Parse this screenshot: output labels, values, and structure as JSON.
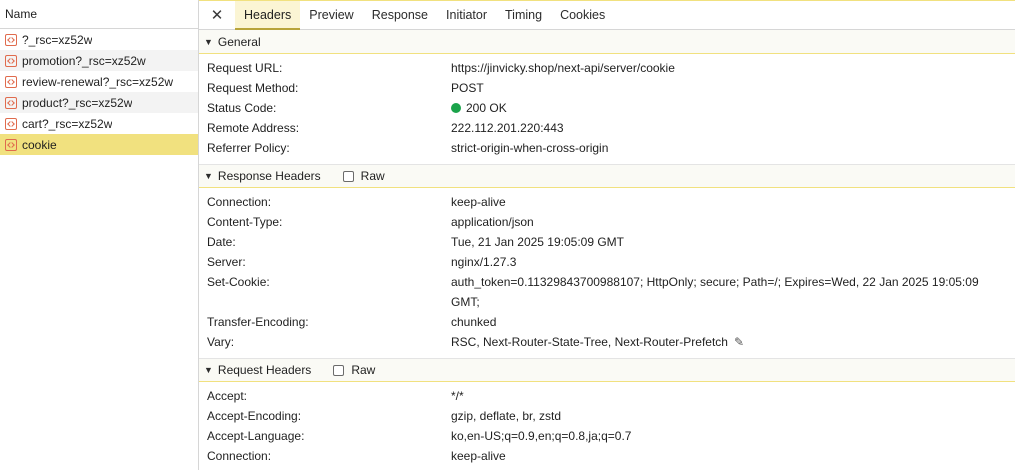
{
  "requests": {
    "header": "Name",
    "items": [
      {
        "label": "?_rsc=xz52w"
      },
      {
        "label": "promotion?_rsc=xz52w"
      },
      {
        "label": "review-renewal?_rsc=xz52w"
      },
      {
        "label": "product?_rsc=xz52w"
      },
      {
        "label": "cart?_rsc=xz52w"
      },
      {
        "label": "cookie"
      }
    ]
  },
  "tabs": {
    "close": "✕",
    "items": [
      {
        "label": "Headers"
      },
      {
        "label": "Preview"
      },
      {
        "label": "Response"
      },
      {
        "label": "Initiator"
      },
      {
        "label": "Timing"
      },
      {
        "label": "Cookies"
      }
    ]
  },
  "general": {
    "title": "General",
    "rows": [
      {
        "key": "Request URL:",
        "value": "https://jinvicky.shop/next-api/server/cookie"
      },
      {
        "key": "Request Method:",
        "value": "POST"
      },
      {
        "key": "Status Code:",
        "value": "200 OK"
      },
      {
        "key": "Remote Address:",
        "value": "222.112.201.220:443"
      },
      {
        "key": "Referrer Policy:",
        "value": "strict-origin-when-cross-origin"
      }
    ]
  },
  "response_headers": {
    "title": "Response Headers",
    "raw": "Raw",
    "rows": [
      {
        "key": "Connection:",
        "value": "keep-alive"
      },
      {
        "key": "Content-Type:",
        "value": "application/json"
      },
      {
        "key": "Date:",
        "value": "Tue, 21 Jan 2025 19:05:09 GMT"
      },
      {
        "key": "Server:",
        "value": "nginx/1.27.3"
      },
      {
        "key": "Set-Cookie:",
        "value": "auth_token=0.11329843700988107; HttpOnly; secure; Path=/; Expires=Wed, 22 Jan 2025 19:05:09 GMT;"
      },
      {
        "key": "Transfer-Encoding:",
        "value": "chunked"
      },
      {
        "key": "Vary:",
        "value": "RSC, Next-Router-State-Tree, Next-Router-Prefetch"
      }
    ]
  },
  "request_headers": {
    "title": "Request Headers",
    "raw": "Raw",
    "rows": [
      {
        "key": "Accept:",
        "value": "*/*"
      },
      {
        "key": "Accept-Encoding:",
        "value": "gzip, deflate, br, zstd"
      },
      {
        "key": "Accept-Language:",
        "value": "ko,en-US;q=0.9,en;q=0.8,ja;q=0.7"
      },
      {
        "key": "Connection:",
        "value": "keep-alive"
      }
    ]
  },
  "colors": {
    "selected_row": "#f1e17f",
    "status_ok": "#1aa34a"
  }
}
